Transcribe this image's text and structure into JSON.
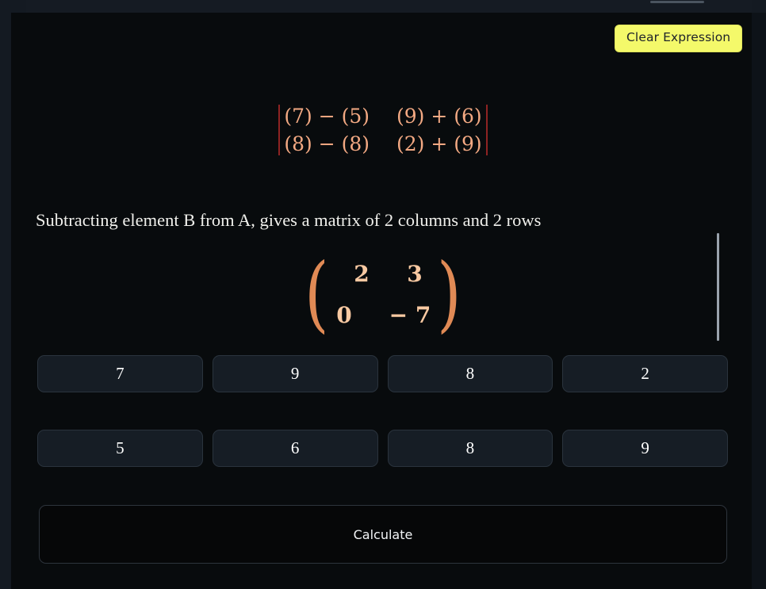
{
  "window": {
    "background_color": "#080b0d",
    "accent_color": "#f4f96a"
  },
  "toolbar": {
    "clear_expression_label": "Clear Expression"
  },
  "expression": {
    "delimiter": "|",
    "delimiter_color": "#8e2323",
    "text_color": "#f3a983",
    "rows": [
      [
        "(7) − (5)",
        "(9) + (6)"
      ],
      [
        "(8) − (8)",
        "(2) + (9)"
      ]
    ]
  },
  "description": {
    "text": "Subtracting element B from A, gives a matrix of 2 columns and 2 rows"
  },
  "result": {
    "open_paren": "(",
    "close_paren": ")",
    "paren_color": "#e08a55",
    "value_color": "#f8c9a2",
    "rows": [
      [
        "2",
        "3"
      ],
      [
        "0",
        "− 7"
      ]
    ]
  },
  "keypad": {
    "rows": [
      {
        "buttons": [
          "7",
          "9",
          "8",
          "2"
        ]
      },
      {
        "buttons": [
          "5",
          "6",
          "8",
          "9"
        ]
      }
    ]
  },
  "actions": {
    "calculate_label": "Calculate"
  }
}
